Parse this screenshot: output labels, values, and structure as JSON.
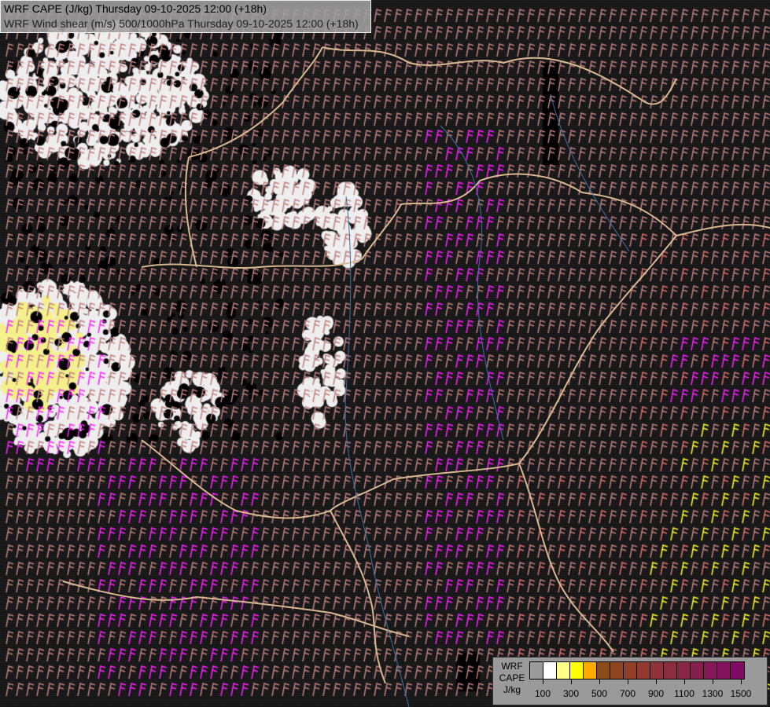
{
  "title": {
    "line1": "WRF CAPE (J/kg) Thursday 09-10-2025 12:00 (+18h)",
    "line2": "WRF Wind shear (m/s) 500/1000hPa Thursday 09-10-2025 12:00 (+18h)"
  },
  "legend": {
    "label_lines": [
      "WRF",
      "CAPE",
      "J/kg"
    ],
    "colors": [
      "#9a9a9a",
      "#ffffff",
      "#ffff88",
      "#ffff00",
      "#ffaa00",
      "#8b4c1a",
      "#8e4620",
      "#913f28",
      "#903a30",
      "#8e3338",
      "#8b2c40",
      "#892646",
      "#871f4e",
      "#851856",
      "#83115e",
      "#820866"
    ],
    "tick_labels": [
      "100",
      "300",
      "500",
      "700",
      "900",
      "1100",
      "1300",
      "1500"
    ]
  },
  "colors": {
    "barb_weak": "#c08080",
    "barb_moderate": "#e07070",
    "barb_strong": "#ff22ff",
    "barb_yellow": "#ffff22",
    "border": "#d8b890",
    "river": "#3a6ea8"
  }
}
